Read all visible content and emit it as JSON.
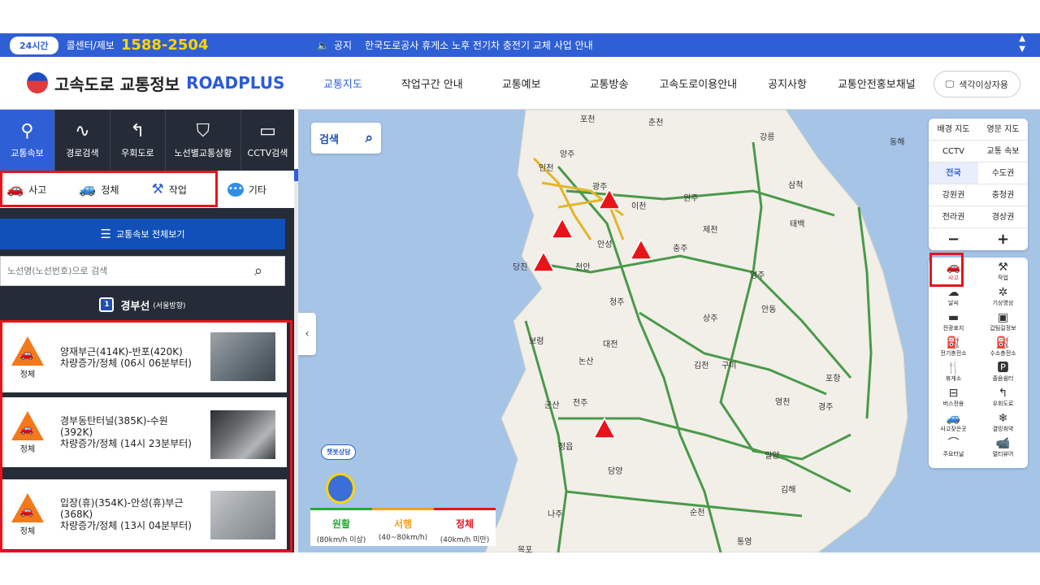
{
  "topbar": {
    "badge": "24시간",
    "callcenter": "콜센터/제보",
    "phone": "1588-2504",
    "notice_label": "공지",
    "notice_text": "한국도로공사 휴게소 노후 전기차 충전기 교체 사업 안내"
  },
  "header": {
    "logo_ko": "고속도로 교통정보",
    "logo_en": "ROADPLUS",
    "nav": [
      "교통지도",
      "작업구간 안내",
      "교통예보",
      "교통방송",
      "고속도로이용안내",
      "공지사항",
      "교통안전홍보채널"
    ],
    "color_button": "색각이상자용"
  },
  "sidebar": {
    "tabs": [
      "교통속보",
      "경로검색",
      "우회도로",
      "노선별교통상황",
      "CCTV검색"
    ],
    "filters": [
      "사고",
      "정체",
      "작업",
      "기타"
    ],
    "all_button": "교통속보 전체보기",
    "search_placeholder": "노선명(노선번호)으로 검색",
    "route": {
      "number": "1",
      "name": "경부선",
      "direction": "(서울방향)"
    },
    "cards": [
      {
        "type": "정체",
        "line1": "양재부근(414K)-반포(420K)",
        "line2": "차량증가/정체 (06시 06분부터)",
        "line3": ""
      },
      {
        "type": "정체",
        "line1": "경부동탄터널(385K)-수원",
        "line2": "(392K)",
        "line3": "차량증가/정체 (14시 23분부터)"
      },
      {
        "type": "정체",
        "line1": "입장(휴)(354K)-안성(휴)부근",
        "line2": "(368K)",
        "line3": "차량증가/정체 (13시 04분부터)"
      }
    ]
  },
  "map": {
    "search_label": "검색",
    "chatbot": "챗봇상담",
    "legend": [
      {
        "label": "원활",
        "range": "(80km/h 이상)",
        "color": "#2aa835"
      },
      {
        "label": "서행",
        "range": "(40~80km/h)",
        "color": "#f0a21b"
      },
      {
        "label": "정체",
        "range": "(40km/h 미만)",
        "color": "#e8141a"
      }
    ],
    "panel": [
      [
        "배경 지도",
        "영문 지도"
      ],
      [
        "CCTV",
        "교통 속보"
      ],
      [
        "전국",
        "수도권"
      ],
      [
        "강원권",
        "충청권"
      ],
      [
        "전라권",
        "경상권"
      ],
      [
        "−",
        "+"
      ]
    ],
    "layers": [
      [
        "사고",
        "작업"
      ],
      [
        "날씨",
        "기상영상"
      ],
      [
        "전광표지",
        "갑팀길정보"
      ],
      [
        "전기충전소",
        "수소충전소"
      ],
      [
        "휴게소",
        "졸음쉼터"
      ],
      [
        "버스전용",
        "우회도로"
      ],
      [
        "사고잦은곳",
        "결빙취약"
      ],
      [
        "주요터널",
        "멀티뷰어"
      ]
    ],
    "cities": [
      "포천",
      "춘천",
      "강릉",
      "동해",
      "삼척",
      "태백",
      "양주",
      "인천",
      "광주",
      "이천",
      "원주",
      "제천",
      "안성",
      "충주",
      "당진",
      "천안",
      "영주",
      "청주",
      "안동",
      "보령",
      "대전",
      "상주",
      "논산",
      "김천",
      "구미",
      "포항",
      "군산",
      "전주",
      "경주",
      "영천",
      "정읍",
      "밀양",
      "담양",
      "김해",
      "나주",
      "순천",
      "통영",
      "목포"
    ]
  }
}
